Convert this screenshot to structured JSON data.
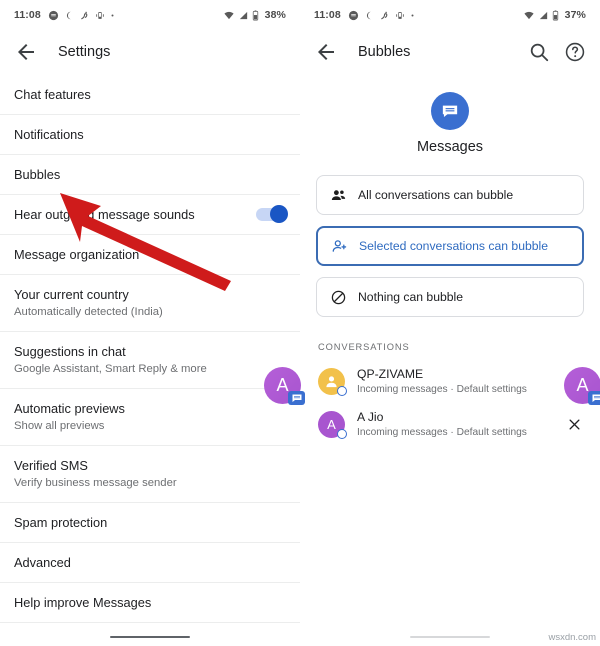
{
  "left_screen": {
    "statusbar": {
      "time": "11:08",
      "battery": "38%",
      "icons": [
        "chat-icon",
        "do-not-disturb-icon",
        "nfc-icon",
        "vibrate-icon",
        "dot-icon",
        "wifi-icon",
        "signal-icon",
        "battery-icon"
      ]
    },
    "appbar": {
      "back": "back-arrow-icon",
      "title": "Settings"
    },
    "items": [
      {
        "title": "Chat features",
        "subtitle": "",
        "toggle": null
      },
      {
        "title": "Notifications",
        "subtitle": "",
        "toggle": null
      },
      {
        "title": "Bubbles",
        "subtitle": "",
        "toggle": null
      },
      {
        "title": "Hear outgoing message sounds",
        "subtitle": "",
        "toggle": "on"
      },
      {
        "title": "Message organization",
        "subtitle": "",
        "toggle": null
      },
      {
        "title": "Your current country",
        "subtitle": "Automatically detected (India)",
        "toggle": null
      },
      {
        "title": "Suggestions in chat",
        "subtitle": "Google Assistant, Smart Reply & more",
        "toggle": null
      },
      {
        "title": "Automatic previews",
        "subtitle": "Show all previews",
        "toggle": null
      },
      {
        "title": "Verified SMS",
        "subtitle": "Verify business message sender",
        "toggle": null
      },
      {
        "title": "Spam protection",
        "subtitle": "",
        "toggle": null
      },
      {
        "title": "Advanced",
        "subtitle": "",
        "toggle": null
      },
      {
        "title": "Help improve Messages",
        "subtitle": "",
        "toggle": null
      }
    ],
    "annotation": {
      "type": "red-arrow",
      "points_to": "Bubbles",
      "color": "#cf1b1b"
    },
    "chathead": {
      "letter": "A",
      "color": "#a855cf"
    }
  },
  "right_screen": {
    "statusbar": {
      "time": "11:08",
      "battery": "37%"
    },
    "appbar": {
      "back": "back-arrow-icon",
      "title": "Bubbles",
      "actions": [
        "search-icon",
        "help-icon"
      ]
    },
    "app": {
      "icon": "messages-icon",
      "name": "Messages",
      "icon_color": "#3a6fd0"
    },
    "options": [
      {
        "id": "all",
        "icon": "group-people-icon",
        "label": "All conversations can bubble",
        "selected": false
      },
      {
        "id": "selected",
        "icon": "person-add-icon",
        "label": "Selected conversations can bubble",
        "selected": true
      },
      {
        "id": "nothing",
        "icon": "block-icon",
        "label": "Nothing can bubble",
        "selected": false
      }
    ],
    "selected_accent": "#3b6cb3",
    "conversations_header": "CONVERSATIONS",
    "conversations": [
      {
        "avatar_letter": "",
        "avatar_type": "person",
        "avatar_color": "#f2c14b",
        "name": "QP-ZIVAME",
        "subtitle": "Incoming messages · Default settings",
        "remove": "close-icon"
      },
      {
        "avatar_letter": "A",
        "avatar_type": "letter",
        "avatar_color": "#a855cf",
        "name": "A Jio",
        "subtitle": "Incoming messages · Default settings",
        "remove": "close-icon"
      }
    ],
    "chathead": {
      "letter": "A",
      "color": "#a855cf"
    }
  },
  "watermark": "wsxdn.com"
}
